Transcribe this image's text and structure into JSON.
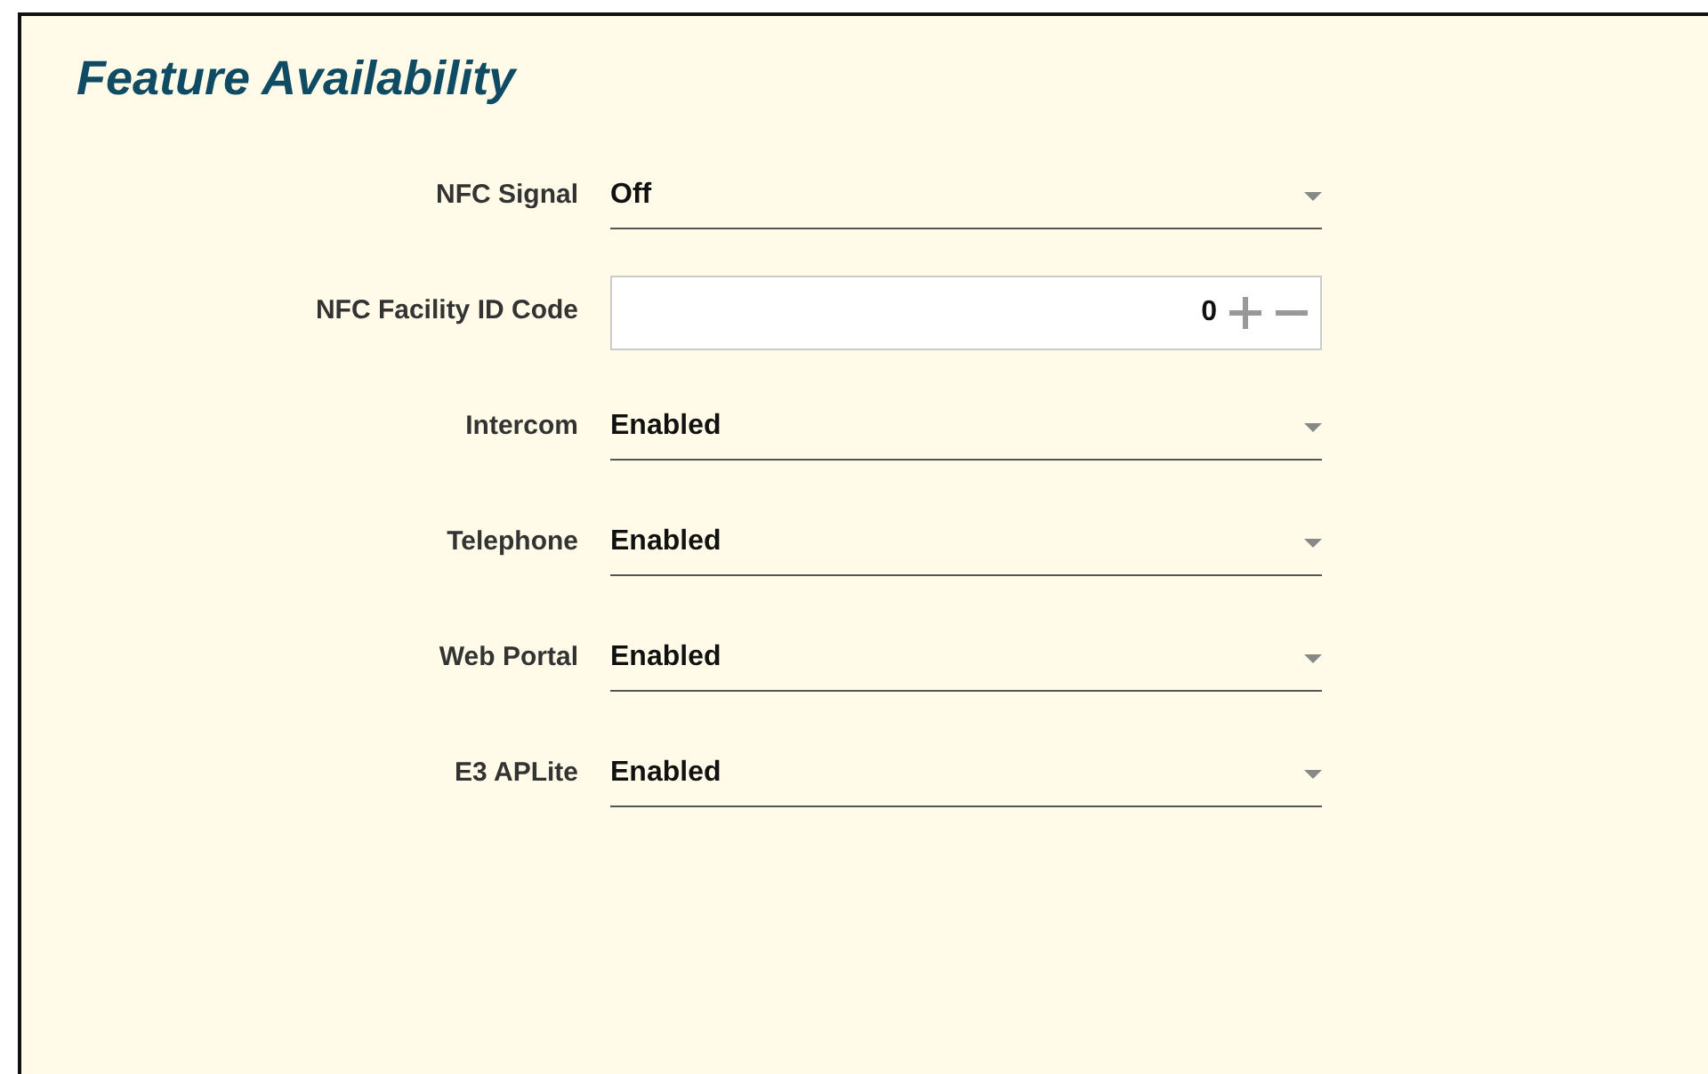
{
  "title": "Feature Availability",
  "fields": [
    {
      "label": "NFC Signal",
      "kind": "select",
      "value": "Off"
    },
    {
      "label": "NFC Facility ID Code",
      "kind": "number",
      "value": "0"
    },
    {
      "label": "Intercom",
      "kind": "select",
      "value": "Enabled"
    },
    {
      "label": "Telephone",
      "kind": "select",
      "value": "Enabled"
    },
    {
      "label": "Web Portal",
      "kind": "select",
      "value": "Enabled"
    },
    {
      "label": "E3 APLite",
      "kind": "select",
      "value": "Enabled"
    }
  ]
}
